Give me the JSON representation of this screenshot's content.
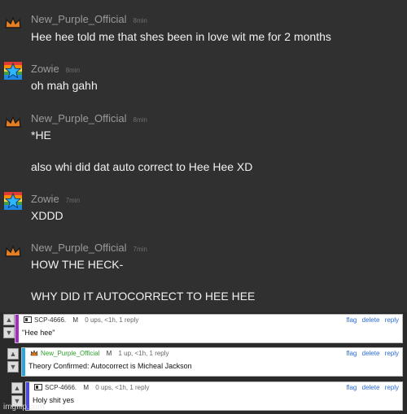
{
  "messages": [
    {
      "user": "New_Purple_Official",
      "time": "8min",
      "avatar": "crown-icon",
      "lines": [
        "Hee hee told me that shes been in love wit me for 2 months"
      ]
    },
    {
      "user": "Zowie",
      "time": "8min",
      "avatar": "rainbow-star-icon",
      "lines": [
        "oh mah gahh"
      ]
    },
    {
      "user": "New_Purple_Official",
      "time": "8min",
      "avatar": "crown-icon",
      "lines": [
        "*HE",
        "also whi did dat auto correct to Hee Hee XD"
      ]
    },
    {
      "user": "Zowie",
      "time": "7min",
      "avatar": "rainbow-star-icon",
      "lines": [
        "XDDD"
      ]
    },
    {
      "user": "New_Purple_Official",
      "time": "7min",
      "avatar": "crown-icon",
      "lines": [
        "HOW THE HECK-",
        "WHY DID IT AUTOCORRECT TO HEE HEE"
      ]
    }
  ],
  "comments": [
    {
      "user": "SCP-4666.",
      "mod": "M",
      "meta": "0 ups, <1h, 1 reply",
      "text": "\"Hee hee\"",
      "bar_color": "#a52cc4",
      "user_color": "#333333"
    },
    {
      "user": "New_Purple_Official",
      "mod": "M",
      "meta": "1 up, <1h, 1 reply",
      "text": "Theory Confirmed: Autocorrect is Micheal Jackson",
      "bar_color": "#27a6e0",
      "user_color": "#2aa22a"
    },
    {
      "user": "SCP-4666.",
      "mod": "M",
      "meta": "0 ups, <1h, 1 reply",
      "text": "Holy shit yes",
      "bar_color": "#4b4bd6",
      "user_color": "#333333"
    }
  ],
  "comment_actions": {
    "flag": "flag",
    "delete": "delete",
    "reply": "reply"
  },
  "watermark": "imgflip.com",
  "colors": {
    "bg": "#303030",
    "username": "#9a9a9a",
    "message": "#f0f0f0",
    "link": "#2a6bd6"
  }
}
